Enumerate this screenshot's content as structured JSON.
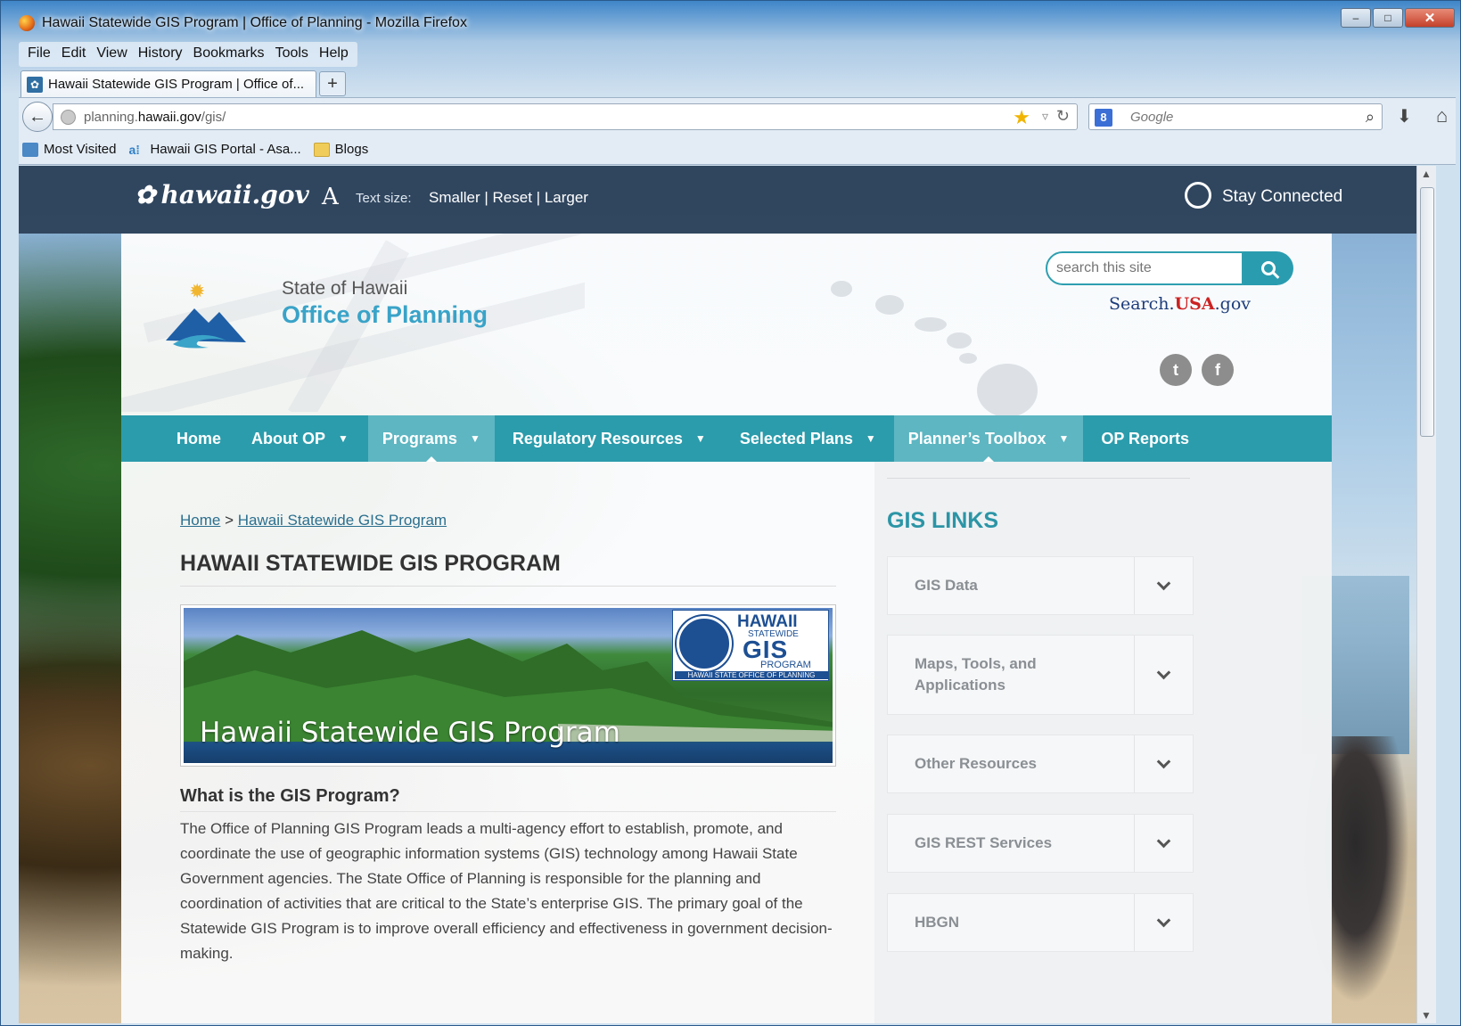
{
  "window": {
    "title": "Hawaii Statewide GIS Program | Office of Planning - Mozilla Firefox",
    "controls": {
      "minimize": "–",
      "maximize": "□",
      "close": "✕"
    }
  },
  "menubar": [
    "File",
    "Edit",
    "View",
    "History",
    "Bookmarks",
    "Tools",
    "Help"
  ],
  "tabs": [
    {
      "label": "Hawaii Statewide GIS Program | Office of..."
    }
  ],
  "new_tab": "+",
  "navbar": {
    "back": "←",
    "url_prefix": "planning.",
    "url_domain": "hawaii.gov",
    "url_path": "/gis/",
    "star": "★",
    "dropdown": "▿",
    "reload": "↻",
    "search_engine": "8",
    "search_placeholder": "Google",
    "search_icon": "⌕",
    "download": "⬇",
    "home": "⌂"
  },
  "bookmarks": [
    {
      "label": "Most Visited",
      "icon": "most-visited-icon"
    },
    {
      "label": "Hawaii GIS Portal - Asa...",
      "icon": "portal-icon"
    },
    {
      "label": "Blogs",
      "icon": "folder-icon"
    }
  ],
  "govbar": {
    "logo": "hawaii.gov",
    "textsize_glyph": "A",
    "textsize_label": "Text size:",
    "textsize_smaller": "Smaller",
    "textsize_reset": "Reset",
    "textsize_larger": "Larger",
    "separator": "|",
    "stay_connected": "Stay Connected"
  },
  "header": {
    "state": "State of Hawaii",
    "office": "Office of Planning",
    "search_placeholder": "search this site",
    "search_usa_prefix": "Search.",
    "search_usa_brand": "USA",
    "search_usa_suffix": ".gov",
    "twitter": "t",
    "facebook": "f"
  },
  "nav": [
    {
      "label": "Home",
      "dropdown": false,
      "active": false
    },
    {
      "label": "About OP",
      "dropdown": true,
      "active": false
    },
    {
      "label": "Programs",
      "dropdown": true,
      "active": true
    },
    {
      "label": "Regulatory Resources",
      "dropdown": true,
      "active": false
    },
    {
      "label": "Selected Plans",
      "dropdown": true,
      "active": false
    },
    {
      "label": "Planner’s Toolbox",
      "dropdown": true,
      "active": true
    },
    {
      "label": "OP Reports",
      "dropdown": false,
      "active": false
    }
  ],
  "breadcrumb": {
    "home": "Home",
    "sep": ">",
    "current": "Hawaii Statewide GIS Program"
  },
  "content": {
    "title": "HAWAII STATEWIDE GIS PROGRAM",
    "banner_text": "Hawaii Statewide GIS Program",
    "badge": {
      "hawaii": "HAWAII",
      "statewide": "STATEWIDE",
      "gis": "GIS",
      "program": "PROGRAM",
      "office": "HAWAII STATE OFFICE OF PLANNING"
    },
    "subheading": "What is the GIS Program?",
    "body": "The Office of Planning GIS Program leads a multi-agency effort to establish, promote, and coordinate the use of geographic information systems (GIS) technology among Hawaii State Government agencies. The State Office of Planning is responsible for the planning and coordination of activities that are critical to the State’s enterprise GIS. The primary goal of the Statewide GIS Program is to improve overall efficiency and effectiveness in government decision-making."
  },
  "sidebar": {
    "title": "GIS LINKS",
    "items": [
      {
        "label": "GIS Data"
      },
      {
        "label": "Maps, Tools, and Applications"
      },
      {
        "label": "Other Resources"
      },
      {
        "label": "GIS REST Services"
      },
      {
        "label": "HBGN"
      }
    ]
  },
  "colors": {
    "accent": "#2b9cac",
    "title_blue": "#3aa3c8",
    "govbar": "#24384e"
  }
}
